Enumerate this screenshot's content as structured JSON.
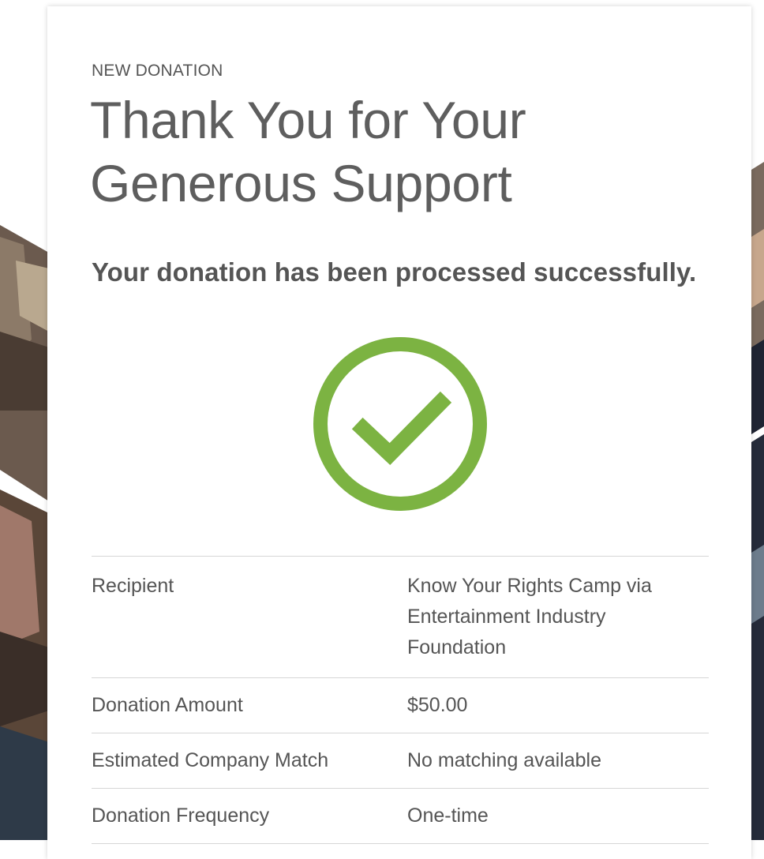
{
  "card": {
    "eyebrow": "NEW DONATION",
    "headline_line1": "Thank You for Your",
    "headline_line2": "Generous Support",
    "status_message": "Your donation has been processed successfully."
  },
  "icons": {
    "success": "check-circle-icon"
  },
  "colors": {
    "success_green": "#7cb342",
    "text": "#555555",
    "divider": "#d6d6d6"
  },
  "details": [
    {
      "label": "Recipient",
      "value": "Know Your Rights Camp via Entertainment Industry Foundation"
    },
    {
      "label": "Donation Amount",
      "value": "$50.00"
    },
    {
      "label": "Estimated Company Match",
      "value": "No matching available"
    },
    {
      "label": "Donation Frequency",
      "value": "One-time"
    }
  ]
}
